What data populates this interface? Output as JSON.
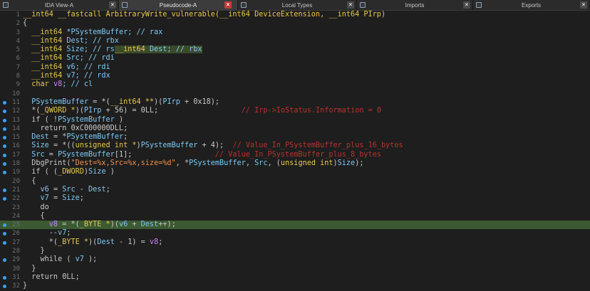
{
  "tabs": [
    {
      "label": "IDA View-A",
      "active": false,
      "icon": "disassembly-icon",
      "close": "grey"
    },
    {
      "label": "Pseudocode-A",
      "active": true,
      "icon": "pseudocode-icon",
      "close": "red"
    },
    {
      "label": "Local Types",
      "active": false,
      "icon": "types-icon",
      "close": "grey"
    },
    {
      "label": "Imports",
      "active": false,
      "icon": "imports-icon",
      "close": "grey"
    },
    {
      "label": "Exports",
      "active": false,
      "icon": "exports-icon",
      "close": "grey"
    }
  ],
  "code": {
    "highlighted_line": 25,
    "lines": [
      {
        "n": "1",
        "dot": false,
        "segs": [
          [
            "t-type",
            "__int64 __fastcall ArbitraryWrite_vulnerable(__int64 DeviceExtension, __int64 PIrp)"
          ]
        ]
      },
      {
        "n": "2",
        "dot": false,
        "segs": [
          [
            "",
            "{"
          ]
        ]
      },
      {
        "n": "3",
        "dot": false,
        "segs": [
          [
            "t-type",
            "  __int64 "
          ],
          [
            "t-var",
            "*PSystemBuffer; // rax"
          ]
        ]
      },
      {
        "n": "4",
        "dot": false,
        "segs": [
          [
            "t-type",
            "  __int64 "
          ],
          [
            "t-var",
            "Dest; // rbx"
          ]
        ]
      },
      {
        "n": "5",
        "dot": false,
        "segs": [
          [
            "t-type",
            "  __int64 "
          ],
          [
            "t-var",
            "Size; // rs"
          ],
          [
            "t-type t-hlbox",
            "__int64 "
          ],
          [
            "t-var t-hlbox",
            "Dest; // rbx"
          ]
        ]
      },
      {
        "n": "6",
        "dot": false,
        "segs": [
          [
            "t-type",
            "  __int64 "
          ],
          [
            "t-var",
            "Src; // rdi"
          ]
        ]
      },
      {
        "n": "7",
        "dot": false,
        "segs": [
          [
            "t-type",
            "  __int64 "
          ],
          [
            "t-var",
            "v6; // rdi"
          ]
        ]
      },
      {
        "n": "8",
        "dot": false,
        "segs": [
          [
            "t-type",
            "  __int64 "
          ],
          [
            "t-var",
            "v7; // rdx"
          ]
        ]
      },
      {
        "n": "9",
        "dot": false,
        "segs": [
          [
            "t-type",
            "  char "
          ],
          [
            "t-v8",
            "v8"
          ],
          [
            "t-var",
            "; // cl"
          ]
        ]
      },
      {
        "n": "10",
        "dot": false,
        "segs": [
          [
            "",
            ""
          ]
        ]
      },
      {
        "n": "11",
        "dot": true,
        "segs": [
          [
            "t-var",
            "  PSystemBuffer"
          ],
          [
            "",
            " = *("
          ],
          [
            "t-type",
            "__int64 **"
          ],
          [
            "",
            ")("
          ],
          [
            "t-var",
            "PIrp"
          ],
          [
            "",
            " + 0x18);"
          ]
        ]
      },
      {
        "n": "12",
        "dot": true,
        "segs": [
          [
            "",
            "  *("
          ],
          [
            "t-type",
            "_QWORD *"
          ],
          [
            "",
            ")("
          ],
          [
            "t-var",
            "PIrp"
          ],
          [
            "",
            " + 56) = 0LL;                   "
          ],
          [
            "t-com",
            "// Irp->IoStatus.Information = 0"
          ]
        ]
      },
      {
        "n": "13",
        "dot": true,
        "segs": [
          [
            "",
            "  if ( !"
          ],
          [
            "t-var",
            "PSystemBuffer"
          ],
          [
            "",
            " )"
          ]
        ]
      },
      {
        "n": "14",
        "dot": true,
        "segs": [
          [
            "",
            "    return 0xC000000DLL;"
          ]
        ]
      },
      {
        "n": "15",
        "dot": true,
        "segs": [
          [
            "t-var",
            "  Dest"
          ],
          [
            "",
            " = *"
          ],
          [
            "t-var",
            "PSystemBuffer"
          ],
          [
            "",
            ";"
          ]
        ]
      },
      {
        "n": "16",
        "dot": true,
        "segs": [
          [
            "t-var",
            "  Size"
          ],
          [
            "",
            " = *(("
          ],
          [
            "t-type",
            "unsigned int *"
          ],
          [
            "",
            ")"
          ],
          [
            "t-var",
            "PSystemBuffer"
          ],
          [
            "",
            " + 4);  "
          ],
          [
            "t-com",
            "// Value_In_PSystemBuffer_plus_16_bytes"
          ]
        ]
      },
      {
        "n": "17",
        "dot": true,
        "segs": [
          [
            "t-var",
            "  Src"
          ],
          [
            "",
            " = "
          ],
          [
            "t-var",
            "PSystemBuffer"
          ],
          [
            "",
            "[1];                   "
          ],
          [
            "t-com",
            "// Value_In_PSystemBuffer_plus_8_bytes"
          ]
        ]
      },
      {
        "n": "18",
        "dot": true,
        "segs": [
          [
            "",
            "  DbgPrint("
          ],
          [
            "t-str",
            "\"Dest=%x,Src=%x,size=%d\""
          ],
          [
            "",
            ", *"
          ],
          [
            "t-var",
            "PSystemBuffer"
          ],
          [
            "",
            ", "
          ],
          [
            "t-var",
            "Src"
          ],
          [
            "",
            ", ("
          ],
          [
            "t-type",
            "unsigned int"
          ],
          [
            "",
            ")"
          ],
          [
            "t-var",
            "Size"
          ],
          [
            "",
            ");"
          ]
        ]
      },
      {
        "n": "19",
        "dot": true,
        "segs": [
          [
            "",
            "  if ( ("
          ],
          [
            "t-type",
            "_DWORD"
          ],
          [
            "",
            ")"
          ],
          [
            "t-var",
            "Size"
          ],
          [
            "",
            " )"
          ]
        ]
      },
      {
        "n": "20",
        "dot": false,
        "segs": [
          [
            "",
            "  {"
          ]
        ]
      },
      {
        "n": "21",
        "dot": true,
        "segs": [
          [
            "t-var",
            "    v6"
          ],
          [
            "",
            " = "
          ],
          [
            "t-var",
            "Src"
          ],
          [
            "",
            " - "
          ],
          [
            "t-var",
            "Dest"
          ],
          [
            "",
            ";"
          ]
        ]
      },
      {
        "n": "22",
        "dot": true,
        "segs": [
          [
            "t-var",
            "    v7"
          ],
          [
            "",
            " = "
          ],
          [
            "t-var",
            "Size"
          ],
          [
            "",
            ";"
          ]
        ]
      },
      {
        "n": "23",
        "dot": false,
        "segs": [
          [
            "",
            "    do"
          ]
        ]
      },
      {
        "n": "24",
        "dot": false,
        "segs": [
          [
            "",
            "    {"
          ]
        ]
      },
      {
        "n": "25",
        "dot": true,
        "segs": [
          [
            "t-v8",
            "      v8"
          ],
          [
            "",
            " = *("
          ],
          [
            "t-type",
            "_BYTE *"
          ],
          [
            "",
            ")("
          ],
          [
            "t-var",
            "v6"
          ],
          [
            "",
            " + "
          ],
          [
            "t-var",
            "Dest"
          ],
          [
            "",
            "++);"
          ]
        ]
      },
      {
        "n": "26",
        "dot": true,
        "segs": [
          [
            "",
            "      --"
          ],
          [
            "t-var",
            "v7"
          ],
          [
            "",
            ";"
          ]
        ]
      },
      {
        "n": "27",
        "dot": true,
        "segs": [
          [
            "",
            "      *("
          ],
          [
            "t-type",
            "_BYTE *"
          ],
          [
            "",
            ")("
          ],
          [
            "t-var",
            "Dest"
          ],
          [
            "",
            " - 1) = "
          ],
          [
            "t-v8",
            "v8"
          ],
          [
            "",
            ";"
          ]
        ]
      },
      {
        "n": "28",
        "dot": false,
        "segs": [
          [
            "",
            "    }"
          ]
        ]
      },
      {
        "n": "29",
        "dot": true,
        "segs": [
          [
            "",
            "    while ( "
          ],
          [
            "t-var",
            "v7"
          ],
          [
            "",
            " );"
          ]
        ]
      },
      {
        "n": "30",
        "dot": false,
        "segs": [
          [
            "",
            "  }"
          ]
        ]
      },
      {
        "n": "31",
        "dot": true,
        "segs": [
          [
            "",
            "  return 0LL;"
          ]
        ]
      },
      {
        "n": "32",
        "dot": true,
        "segs": [
          [
            "",
            "}"
          ]
        ]
      }
    ]
  }
}
